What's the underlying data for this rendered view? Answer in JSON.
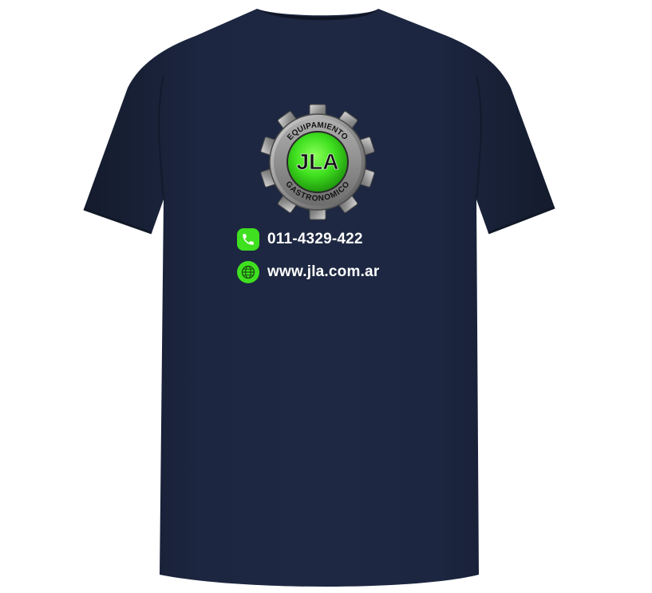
{
  "logo": {
    "top_text": "EQUIPAMIENTO",
    "center_text": "JLA",
    "bottom_text": "GASTRONOMICO"
  },
  "contacts": {
    "phone": {
      "icon": "phone-icon",
      "text": "011-4329-422"
    },
    "web": {
      "icon": "globe-icon",
      "text": "www.jla.com.ar"
    }
  },
  "colors": {
    "shirt": "#1a2339",
    "accent_green": "#3ee01f",
    "gear_gray": "#9a9a9a",
    "text": "#ffffff"
  }
}
